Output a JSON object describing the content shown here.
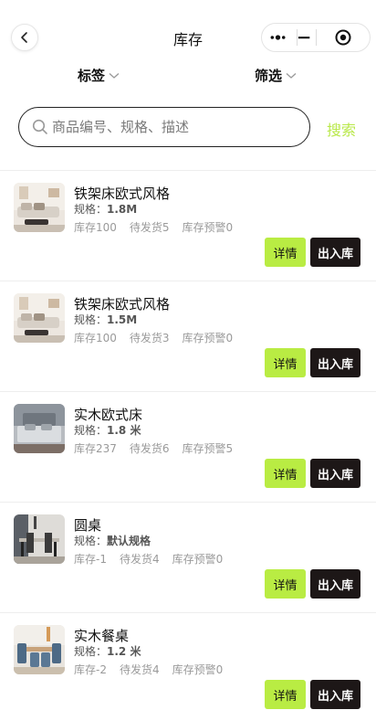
{
  "header": {
    "title": "库存",
    "back_icon": "chevron-left-icon",
    "capsule": {
      "menu_icon": "more-dots-icon",
      "minimize_icon": "minus-icon",
      "close_icon": "target-icon"
    }
  },
  "filters": {
    "tags_label": "标签",
    "screen_label": "筛选"
  },
  "search": {
    "placeholder": "商品编号、规格、描述",
    "button_label": "搜索"
  },
  "colors": {
    "accent": "#b9ec43",
    "dark": "#1d1717"
  },
  "spec_label": "规格：",
  "buttons": {
    "detail": "详情",
    "inout": "出入库"
  },
  "products": [
    {
      "name": "铁架床欧式风格",
      "spec": "1.8M",
      "stock": "库存100",
      "pending": "待发货5",
      "warning": "库存预警0",
      "thumb": "bed-sofa"
    },
    {
      "name": "铁架床欧式风格",
      "spec": "1.5M",
      "stock": "库存100",
      "pending": "待发货3",
      "warning": "库存预警0",
      "thumb": "bed-sofa"
    },
    {
      "name": "实木欧式床",
      "spec": "1.8 米",
      "stock": "库存237",
      "pending": "待发货6",
      "warning": "库存预警5",
      "thumb": "bed-grey"
    },
    {
      "name": "圆桌",
      "spec": "默认规格",
      "stock": "库存-1",
      "pending": "待发货4",
      "warning": "库存预警0",
      "thumb": "dining-dark"
    },
    {
      "name": "实木餐桌",
      "spec": "1.2 米",
      "stock": "库存-2",
      "pending": "待发货4",
      "warning": "库存预警0",
      "thumb": "dining-blue"
    }
  ]
}
